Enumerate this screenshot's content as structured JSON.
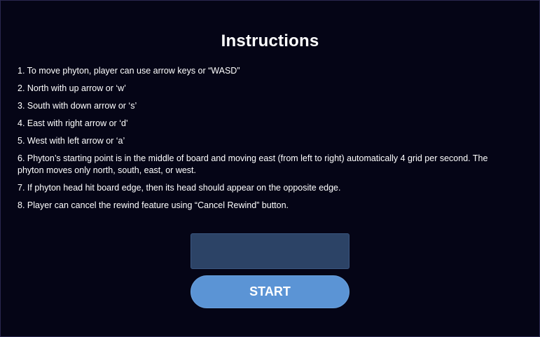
{
  "title": "Instructions",
  "instructions": [
    "1. To move phyton, player can use arrow keys or “WASD”",
    "2. North with up arrow or ‘w’",
    "3. South with down arrow or ‘s’",
    "4. East with right arrow or ‘d’",
    "5. West with left arrow or ‘a’",
    "6. Phyton’s starting point is in the middle of board and moving east (from left to right) automatically 4 grid per second. The phyton moves only north, south, east, or west.",
    "7. If phyton head hit board edge, then its head should appear on the opposite edge.",
    "8. Player can cancel the rewind feature using “Cancel Rewind” button."
  ],
  "name_input": {
    "value": "",
    "placeholder": ""
  },
  "start_button": {
    "label": "START"
  },
  "colors": {
    "background": "#050516",
    "input_fill": "#2c4366",
    "button_fill": "#5b94d5"
  }
}
